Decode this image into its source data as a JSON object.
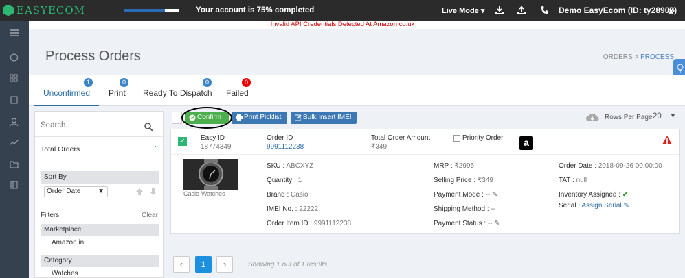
{
  "topbar": {
    "logo": "EASYECOM",
    "progress": 0.75,
    "progress_text": "Your account is 75% completed",
    "live_mode": "Live Mode ▾",
    "account": "Demo EasyEcom (ID: ty28900)"
  },
  "alert": "Invalid API Credentials Detected At Amazon.co.uk",
  "header": {
    "title": "Process Orders",
    "crumb_orders": "ORDERS",
    "crumb_sep": ">",
    "crumb_process": "PROCESS"
  },
  "tabs": [
    {
      "label": "Unconfirmed",
      "count": "1"
    },
    {
      "label": "Print",
      "count": "0"
    },
    {
      "label": "Ready To Dispatch",
      "count": "0"
    },
    {
      "label": "Failed",
      "count": "0"
    }
  ],
  "left": {
    "search_placeholder": "Search...",
    "total_orders": "Total Orders",
    "sort_by": "Sort By",
    "sort_value": "Order Date",
    "filters": "Filters",
    "clear": "Clear",
    "marketplace": "Marketplace",
    "marketplace_value": "Amazon.in",
    "category": "Category",
    "category_value": "Watches"
  },
  "toolbar": {
    "confirm": "Confirm",
    "print_picklist": "Print Picklist",
    "bulk_insert": "Bulk Insert IMEI",
    "rows_label": "Rows Per Page",
    "rows_value": "20"
  },
  "order": {
    "easy_id_label": "Easy ID",
    "easy_id": "18774349",
    "order_id_label": "Order ID",
    "order_id": "9991112238",
    "total_label": "Total Order Amount",
    "total": "₹349",
    "priority": "Priority Order",
    "product_name": "Casio-Watches",
    "sku_label": "SKU :",
    "sku": "ABCXYZ",
    "qty_label": "Quantity :",
    "qty": "1",
    "brand_label": "Brand :",
    "brand": "Casio",
    "imei_label": "IMEI No. :",
    "imei": "22222",
    "item_id_label": "Order Item ID :",
    "item_id": "9991112238",
    "mrp_label": "MRP :",
    "mrp": "₹2995",
    "sp_label": "Selling Price :",
    "sp": "₹349",
    "pay_mode_label": "Payment Mode :",
    "pay_mode": "--",
    "ship_label": "Shipping Method :",
    "ship": "--",
    "pay_status_label": "Payment Status :",
    "pay_status": "--",
    "date_label": "Order Date :",
    "date": "2018-09-26 00:00:00",
    "tat_label": "TAT :",
    "tat": "null",
    "inv_label": "Inventory Assigned :",
    "serial_label": "Serial :",
    "serial": "Assign Serial"
  },
  "pagination": {
    "prev": "‹",
    "page": "1",
    "next": "›",
    "showing": "Showing 1 out of 1 results"
  }
}
